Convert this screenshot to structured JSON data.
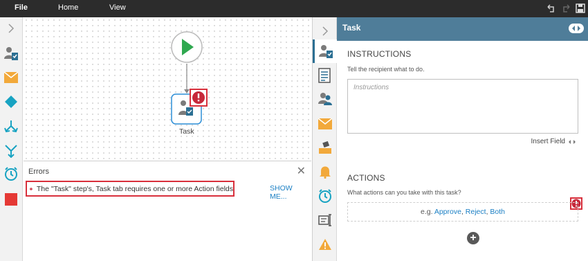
{
  "menu": {
    "file": "File",
    "home": "Home",
    "view": "View"
  },
  "canvas": {
    "task_label": "Task"
  },
  "errors": {
    "title": "Errors",
    "message": "The \"Task\" step's, Task tab requires one or more Action fields",
    "show_more": "SHOW ME..."
  },
  "panel": {
    "title": "Task",
    "instructions_title": "INSTRUCTIONS",
    "instructions_hint": "Tell the recipient what to do.",
    "instructions_placeholder": "Instructions",
    "insert_field": "Insert Field",
    "actions_title": "ACTIONS",
    "actions_hint": "What actions can you take with this task?",
    "example_prefix": "e.g.",
    "approve": "Approve",
    "reject": "Reject",
    "both": "Both",
    "comma": ",",
    "add_symbol": "+"
  },
  "colors": {
    "accent": "#4f7d99",
    "error": "#d8303c",
    "link": "#1a7fc4",
    "start_green": "#2fa84f",
    "teal": "#18a3c2"
  }
}
